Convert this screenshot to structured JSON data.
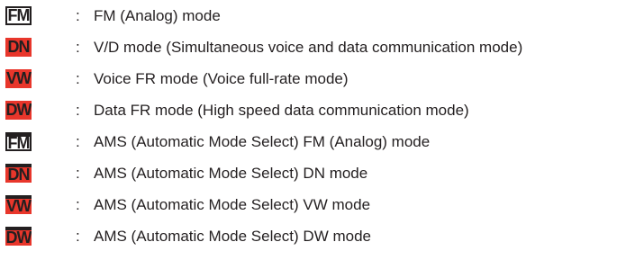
{
  "colors": {
    "text": "#231f20",
    "badge_red": "#e8362b",
    "badge_white": "#ffffff"
  },
  "rows": [
    {
      "badge": "FM",
      "badge_style": "outline",
      "ams": false,
      "separator": ":",
      "text": "FM (Analog) mode"
    },
    {
      "badge": "DN",
      "badge_style": "red",
      "ams": false,
      "separator": ":",
      "text": "V/D mode (Simultaneous voice and data communication mode)"
    },
    {
      "badge": "VW",
      "badge_style": "red",
      "ams": false,
      "separator": ":",
      "text": "Voice FR mode (Voice full-rate mode)"
    },
    {
      "badge": "DW",
      "badge_style": "red",
      "ams": false,
      "separator": ":",
      "text": "Data FR mode (High speed data communication mode)"
    },
    {
      "badge": "FM",
      "badge_style": "outline",
      "ams": true,
      "separator": ":",
      "text": "AMS (Automatic Mode Select)  FM (Analog) mode"
    },
    {
      "badge": "DN",
      "badge_style": "red",
      "ams": true,
      "separator": ":",
      "text": "AMS (Automatic Mode Select)  DN mode"
    },
    {
      "badge": "VW",
      "badge_style": "red",
      "ams": true,
      "separator": ":",
      "text": "AMS (Automatic Mode Select)  VW mode"
    },
    {
      "badge": "DW",
      "badge_style": "red",
      "ams": true,
      "separator": ":",
      "text": "AMS (Automatic Mode Select)  DW mode"
    }
  ]
}
